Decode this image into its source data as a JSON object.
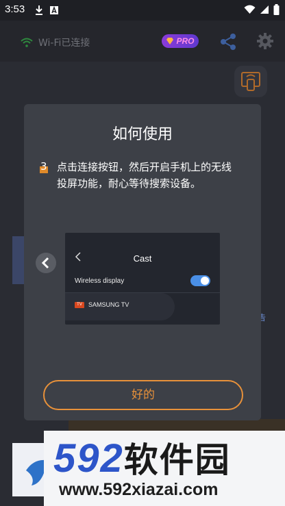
{
  "status_bar": {
    "time": "3:53"
  },
  "header": {
    "wifi_status": "Wi-Fi已连接",
    "pro_badge": "PRO"
  },
  "background": {
    "ad_label": "告"
  },
  "dialog": {
    "title": "如何使用",
    "step_number": "3",
    "step_text": "点击连接按钮，然后开启手机上的无线投屏功能，耐心等待搜索设备。",
    "tutorial": {
      "title": "Cast",
      "wireless_label": "Wireless display",
      "wireless_on": true,
      "device_badge": "TV",
      "device_name": "SAMSUNG TV"
    },
    "ok_button": "好的"
  },
  "watermark": {
    "brand_digits": "592",
    "brand_chinese": "软件园",
    "url": "www.592xiazai.com"
  },
  "colors": {
    "accent": "#e8913a",
    "toggle": "#4a8fe6",
    "pro_gradient_start": "#8a3bd8"
  }
}
